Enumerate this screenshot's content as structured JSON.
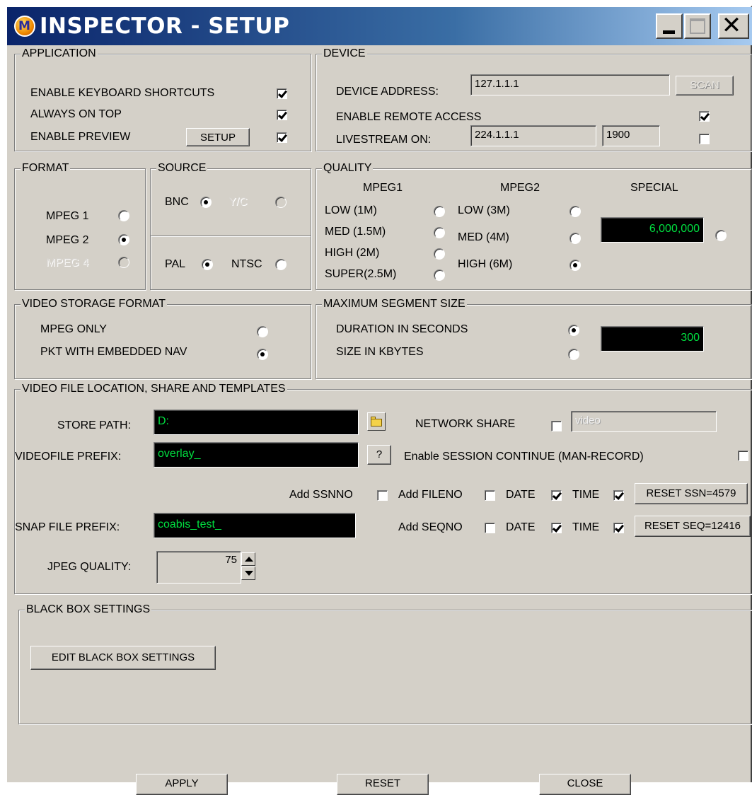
{
  "window": {
    "title": "INSPECTOR - SETUP"
  },
  "application": {
    "legend": "APPLICATION",
    "keyboard_shortcuts_label": "ENABLE KEYBOARD SHORTCUTS",
    "keyboard_shortcuts_checked": true,
    "always_on_top_label": "ALWAYS ON TOP",
    "always_on_top_checked": true,
    "enable_preview_label": "ENABLE PREVIEW",
    "enable_preview_checked": true,
    "setup_button": "SETUP"
  },
  "device": {
    "legend": "DEVICE",
    "address_label": "DEVICE ADDRESS:",
    "address_value": "127.1.1.1",
    "scan_button": "SCAN",
    "remote_access_label": "ENABLE REMOTE ACCESS",
    "remote_access_checked": true,
    "livestream_label": "LIVESTREAM ON:",
    "livestream_ip": "224.1.1.1",
    "livestream_port": "1900",
    "livestream_checked": false
  },
  "format": {
    "legend": "FORMAT",
    "options": [
      "MPEG 1",
      "MPEG 2",
      "MPEG 4"
    ],
    "selected": "MPEG 2"
  },
  "source": {
    "legend": "SOURCE",
    "bnc_label": "BNC",
    "yc_label": "Y/C",
    "selected": "BNC",
    "pal_label": "PAL",
    "ntsc_label": "NTSC",
    "standard": "PAL"
  },
  "quality": {
    "legend": "QUALITY",
    "mpeg1_header": "MPEG1",
    "mpeg2_header": "MPEG2",
    "special_header": "SPECIAL",
    "mpeg1_options": [
      "LOW (1M)",
      "MED (1.5M)",
      "HIGH (2M)",
      "SUPER(2.5M)"
    ],
    "mpeg2_options": [
      "LOW (3M)",
      "MED (4M)",
      "HIGH (6M)"
    ],
    "selected": "HIGH (6M)",
    "special_value": "6,000,000"
  },
  "storage": {
    "legend": "VIDEO STORAGE FORMAT",
    "mpeg_only_label": "MPEG ONLY",
    "pkt_label": "PKT WITH EMBEDDED NAV",
    "selected": "PKT WITH EMBEDDED NAV"
  },
  "segment": {
    "legend": "MAXIMUM SEGMENT SIZE",
    "duration_label": "DURATION IN SECONDS",
    "size_label": "SIZE IN KBYTES",
    "selected": "DURATION IN SECONDS",
    "value": "300"
  },
  "files": {
    "legend": "VIDEO FILE LOCATION, SHARE AND TEMPLATES",
    "store_path_label": "STORE PATH:",
    "store_path_value": "D:",
    "network_share_label": "NETWORK SHARE",
    "network_share_checked": false,
    "network_share_value": "video",
    "videofile_prefix_label": "VIDEOFILE PREFIX:",
    "videofile_prefix_value": "overlay_",
    "help_button": "?",
    "session_continue_label": "Enable SESSION CONTINUE (MAN-RECORD)",
    "session_continue_checked": false,
    "add_ssnno_label": "Add SSNNO",
    "add_ssnno_checked": false,
    "add_fileno_label": "Add FILENO",
    "add_fileno_checked": false,
    "video_date_label": "DATE",
    "video_date_checked": true,
    "video_time_label": "TIME",
    "video_time_checked": true,
    "reset_ssn_button": "RESET SSN=4579",
    "snap_prefix_label": "SNAP FILE PREFIX:",
    "snap_prefix_value": "coabis_test_",
    "add_seqno_label": "Add SEQNO",
    "add_seqno_checked": false,
    "snap_date_label": "DATE",
    "snap_date_checked": true,
    "snap_time_label": "TIME",
    "snap_time_checked": true,
    "reset_seq_button": "RESET SEQ=12416",
    "jpeg_quality_label": "JPEG QUALITY:",
    "jpeg_quality_value": "75"
  },
  "blackbox": {
    "legend": "BLACK BOX SETTINGS",
    "edit_button": "EDIT BLACK BOX SETTINGS"
  },
  "footer": {
    "apply_button": "APPLY",
    "reset_button": "RESET",
    "close_button": "CLOSE"
  }
}
